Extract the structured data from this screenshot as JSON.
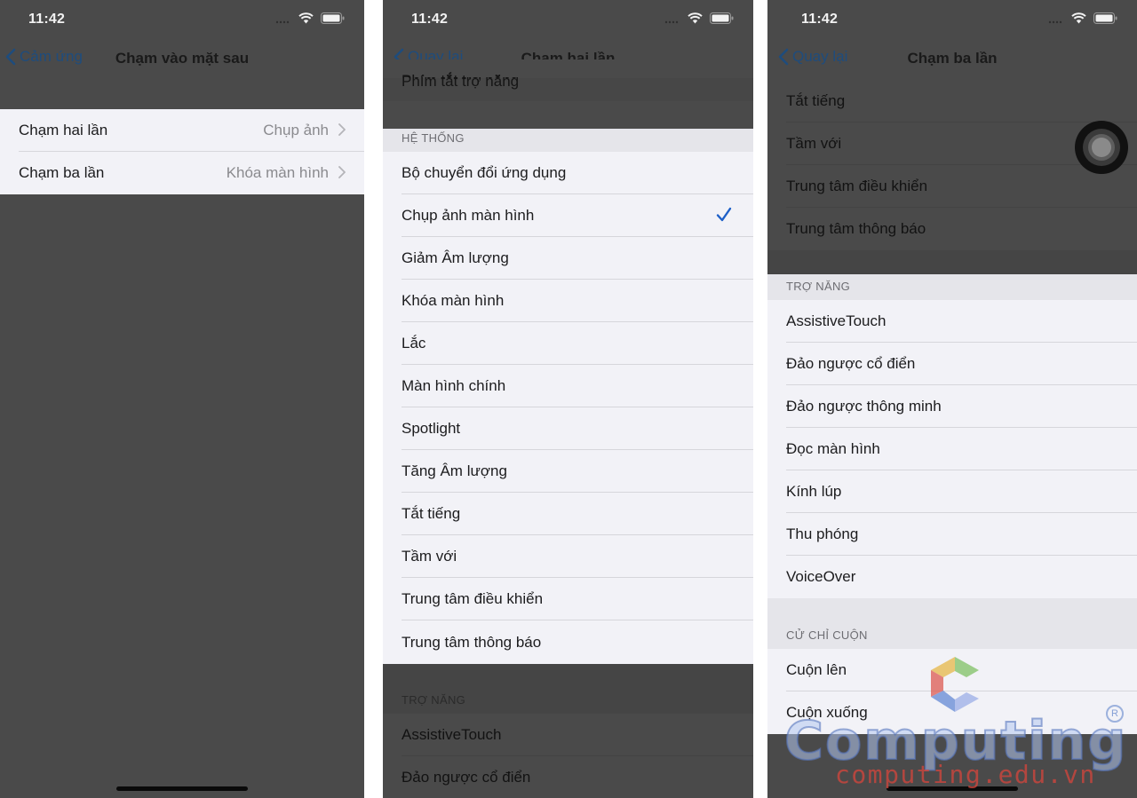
{
  "status_bar": {
    "time": "11:42"
  },
  "screens": [
    {
      "back_label": "Cảm ứng",
      "title": "Chạm vào mặt sau",
      "rows": [
        {
          "label": "Chạm hai lần",
          "value": "Chụp ảnh"
        },
        {
          "label": "Chạm ba lần",
          "value": "Khóa màn hình"
        }
      ]
    },
    {
      "back_label": "Quay lại",
      "title": "Chạm hai lần",
      "partial_top_row": "Phím tắt trợ năng",
      "system_header": "HỆ THỐNG",
      "system_items": [
        "Bộ chuyển đổi ứng dụng",
        "Chụp ảnh màn hình",
        "Giảm Âm lượng",
        "Khóa màn hình",
        "Lắc",
        "Màn hình chính",
        "Spotlight",
        "Tăng Âm lượng",
        "Tắt tiếng",
        "Tầm với",
        "Trung tâm điều khiển",
        "Trung tâm thông báo"
      ],
      "selected_item": "Chụp ảnh màn hình",
      "accessibility_header": "TRỢ NĂNG",
      "accessibility_items": [
        "AssistiveTouch",
        "Đảo ngược cổ điển"
      ]
    },
    {
      "back_label": "Quay lại",
      "title": "Chạm ba lần",
      "system_items": [
        "Tắt tiếng",
        "Tầm với",
        "Trung tâm điều khiển",
        "Trung tâm thông báo"
      ],
      "accessibility_header": "TRỢ NĂNG",
      "accessibility_items": [
        "AssistiveTouch",
        "Đảo ngược cổ điển",
        "Đảo ngược thông minh",
        "Đọc màn hình",
        "Kính lúp",
        "Thu phóng",
        "VoiceOver"
      ],
      "scroll_header": "CỬ CHỈ CUỘN",
      "scroll_items": [
        "Cuộn lên",
        "Cuộn xuống"
      ]
    }
  ],
  "watermark": {
    "title": "Computing",
    "url": "computing.edu.vn",
    "registered_mark": "R"
  },
  "colors": {
    "dim_overlay": "#4a4a4a",
    "cell_background": "#f2f2f7",
    "accent_blue": "#1e60c8",
    "back_link_dimmed": "#1e4c7d"
  },
  "icons": [
    "chevron-left-icon",
    "chevron-right-icon",
    "checkmark-icon",
    "wifi-icon",
    "signal-icon",
    "battery-icon",
    "assistive-touch-icon"
  ]
}
